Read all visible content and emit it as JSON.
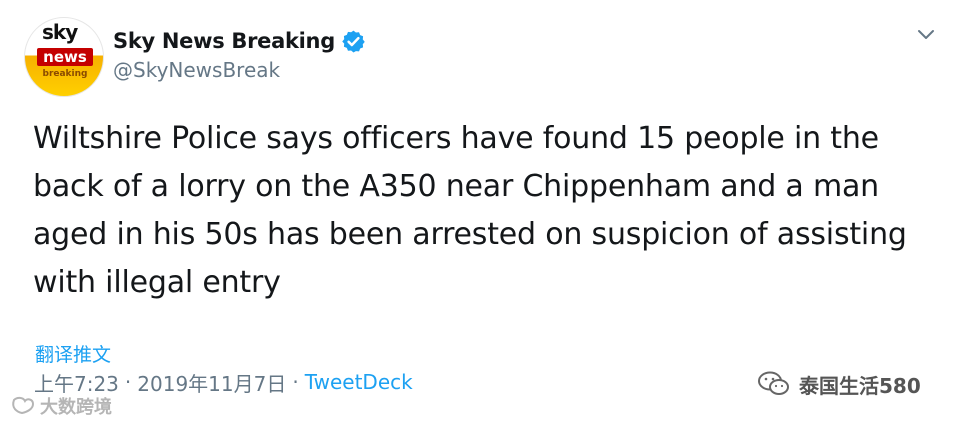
{
  "avatar": {
    "line1": "sky",
    "line2": "news",
    "line3": "breaking"
  },
  "author": {
    "display_name": "Sky News Breaking",
    "handle": "@SkyNewsBreak",
    "verified": true
  },
  "tweet": {
    "text": "Wiltshire Police says officers have found 15 people in the back of a lorry on the A350 near Chippenham and a man aged in his 50s has been arrested on suspicion of assisting with illegal entry",
    "translate_label": "翻译推文",
    "time": "上午7:23",
    "separator": "·",
    "date": "2019年11月7日",
    "source": "TweetDeck"
  },
  "watermarks": {
    "left": "大数跨境",
    "right": "泰国生活580"
  },
  "colors": {
    "link_blue": "#1da1f2",
    "muted_gray": "#657786",
    "text_dark": "#14171a",
    "brand_red": "#c40000",
    "brand_yellow": "#ffd000"
  },
  "icons": {
    "verified": "verified-badge-icon",
    "caret": "chevron-down-icon",
    "watermark_left": "bubble-logo-icon",
    "watermark_right": "wechat-icon"
  }
}
